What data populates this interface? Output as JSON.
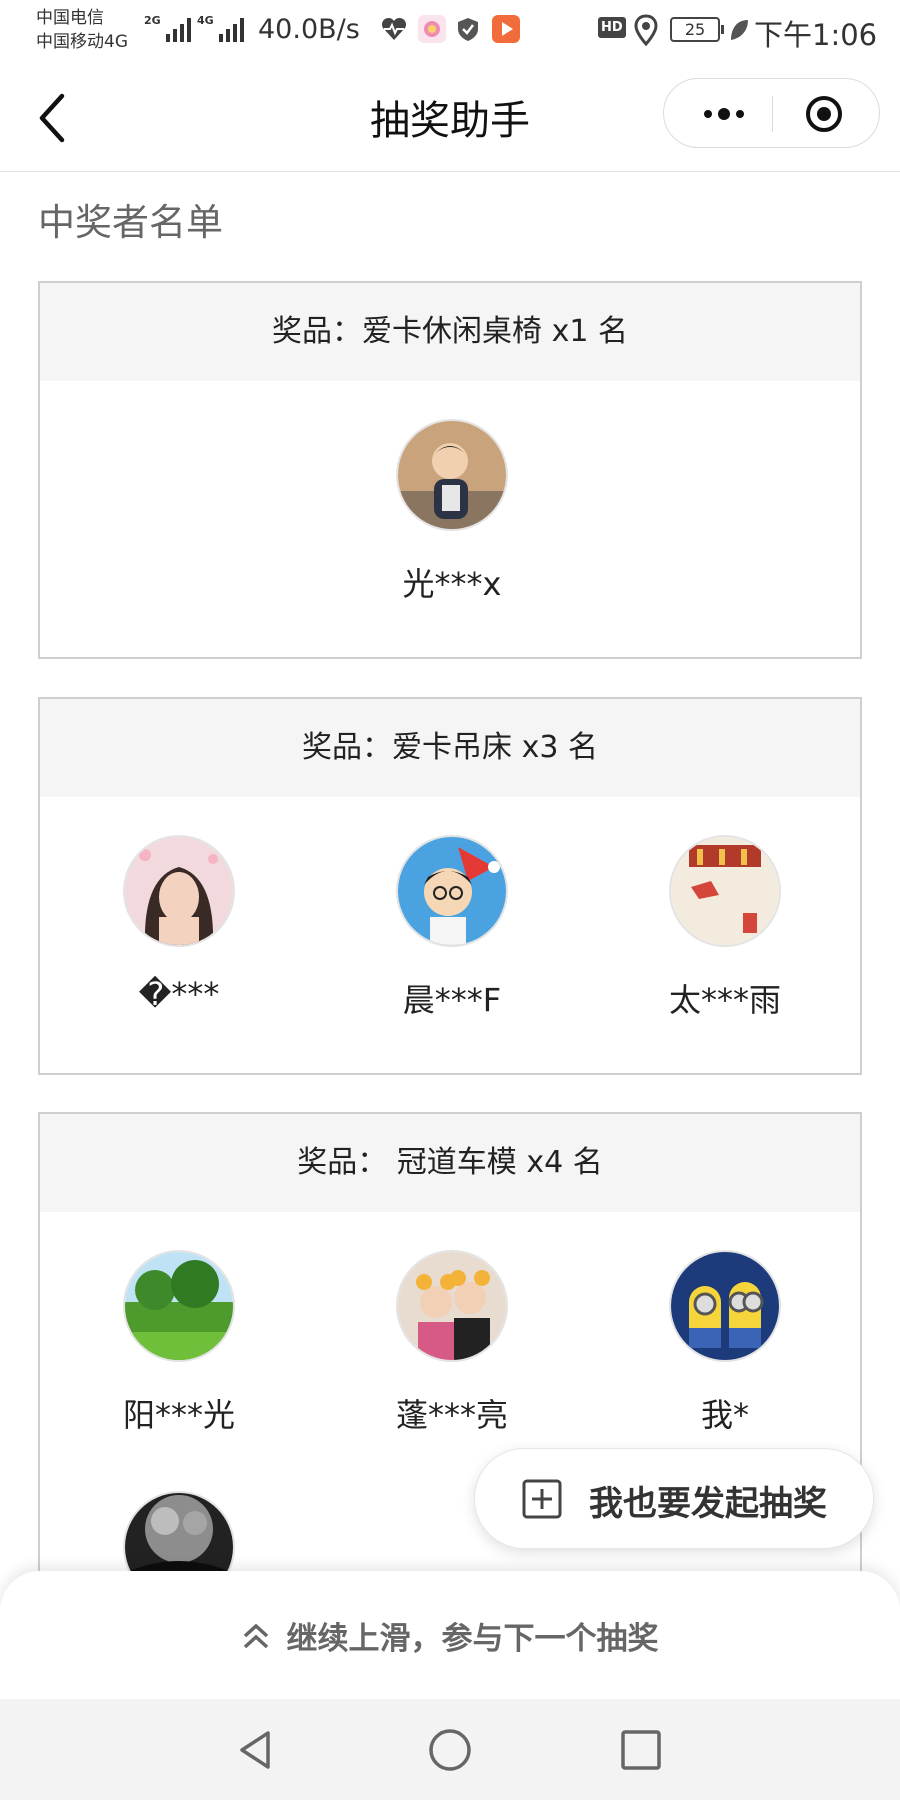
{
  "status_bar": {
    "carrier_1": "中国电信",
    "carrier_2": "中国移动4G",
    "signal_1_tag": "2G",
    "signal_2_tag": "4G",
    "net_speed": "40.0B/s",
    "hd_badge": "HD",
    "battery": "25",
    "time": "下午1:06",
    "colors": {
      "gallery_icon": "#f08bb4",
      "video_icon": "#f26b3a"
    }
  },
  "nav": {
    "title": "抽奖助手",
    "back_icon": "chevron-left-icon",
    "more_icon": "more-dots-icon",
    "close_icon": "target-circle-icon"
  },
  "section_title": "中奖者名单",
  "prizes": [
    {
      "header": "奖品：爱卡休闲桌椅 x1 名",
      "winners": [
        {
          "name": "光***x",
          "avatar": "child-photo"
        }
      ]
    },
    {
      "header": "奖品：爱卡吊床 x3 名",
      "winners": [
        {
          "name": "�***",
          "avatar": "woman-portrait"
        },
        {
          "name": "晨***F",
          "avatar": "cartoon-boy-santa-hat"
        },
        {
          "name": "太***雨",
          "avatar": "red-envelope-scene"
        }
      ]
    },
    {
      "header": "奖品： 冠道车模 x4 名",
      "winners": [
        {
          "name": "阳***光",
          "avatar": "green-landscape"
        },
        {
          "name": "蓬***亮",
          "avatar": "couple-photo"
        },
        {
          "name": "我*",
          "avatar": "minions"
        },
        {
          "name": "",
          "avatar": "black-white-tree"
        }
      ]
    }
  ],
  "fab": {
    "label": "我也要发起抽奖",
    "icon": "plus-square-icon"
  },
  "swipe_hint": {
    "text": "继续上滑，参与下一个抽奖",
    "icon": "double-chevron-up-icon"
  },
  "system_nav": {
    "back": "triangle-back-icon",
    "home": "circle-home-icon",
    "recents": "square-recents-icon"
  }
}
